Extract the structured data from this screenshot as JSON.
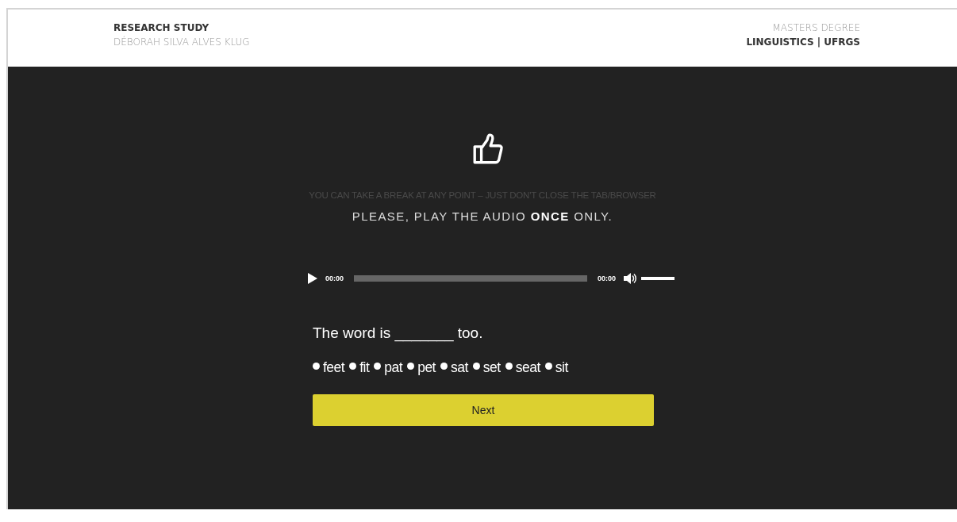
{
  "header": {
    "title": "RESEARCH STUDY",
    "author": "DÉBORAH SILVA ALVES KLUG",
    "degree": "MASTERS DEGREE",
    "institution": "LINGUISTICS | UFRGS"
  },
  "hint": "YOU CAN TAKE A BREAK AT ANY POINT – JUST DON'T CLOSE THE TAB/BROWSER",
  "instruction": "PLEASE, PLAY THE AUDIO **ONCE** ONLY.",
  "player": {
    "current_time": "00:00",
    "duration": "00:00",
    "progress": {
      "level": 0
    },
    "volume": {
      "level": 1
    }
  },
  "question": "The word is _______ too.",
  "options": [
    {
      "label": "feet",
      "selected": false
    },
    {
      "label": "fit",
      "selected": false
    },
    {
      "label": "pat",
      "selected": false
    },
    {
      "label": "pet",
      "selected": false
    },
    {
      "label": "sat",
      "selected": false
    },
    {
      "label": "set",
      "selected": false
    },
    {
      "label": "seat",
      "selected": false
    },
    {
      "label": "sit",
      "selected": false
    }
  ],
  "button": "Next"
}
